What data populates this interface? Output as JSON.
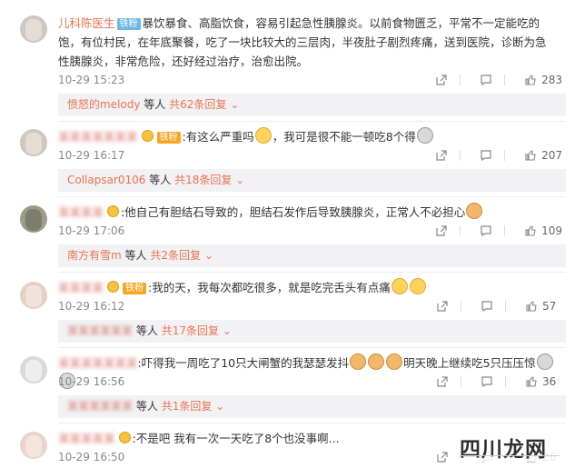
{
  "comments": [
    {
      "user": "儿科陈医生",
      "badge": "铁粉",
      "text": "暴饮暴食、高脂饮食，容易引起急性胰腺炎。以前食物匮乏，平常不一定能吃的饱，有位村民，在年底聚餐，吃了一块比较大的三层肉，半夜肚子剧烈疼痛，送到医院，诊断为急性胰腺炎，非常危险，还好经过治疗，治愈出院。",
      "time": "10-29 15:23",
      "likes": "283",
      "reply_user": "愤怒的melody",
      "reply_text": "等人",
      "reply_count": "共62条回复"
    },
    {
      "user": "",
      "badge": "铁粉",
      "text_a": ":有这么严重吗",
      "text_b": "，我可是很不能一顿吃8个得",
      "time": "10-29 16:17",
      "likes": "207",
      "reply_user": "Collapsar0106",
      "reply_text": "等人",
      "reply_count": "共18条回复"
    },
    {
      "user": "",
      "text": ":他自己有胆结石导致的，胆结石发作后导致胰腺炎，正常人不必担心",
      "time": "10-29 17:06",
      "likes": "109",
      "reply_user": "南方有雪m",
      "reply_text": "等人",
      "reply_count": "共2条回复"
    },
    {
      "user": "",
      "badge": "铁粉",
      "text": ":我的天，我每次都吃很多，就是吃完舌头有点痛",
      "time": "10-29 16:12",
      "likes": "57",
      "reply_user": "",
      "reply_text": "等人",
      "reply_count": "共17条回复"
    },
    {
      "user": "",
      "text_a": ":吓得我一周吃了10只大闸蟹的我瑟瑟发抖",
      "text_b": "明天晚上继续吃5只压压惊",
      "time": "10-29 16:56",
      "likes": "36",
      "reply_user": "",
      "reply_text": "等人",
      "reply_count": "共1条回复"
    },
    {
      "user": "",
      "text": ":不是吧 我有一次一天吃了8个也没事啊...",
      "time": "10-29 16:50",
      "likes": "26"
    }
  ],
  "watermark": "四川龙网",
  "icons": [
    "share-icon",
    "comment-icon",
    "like-icon",
    "chevron-down-icon"
  ]
}
